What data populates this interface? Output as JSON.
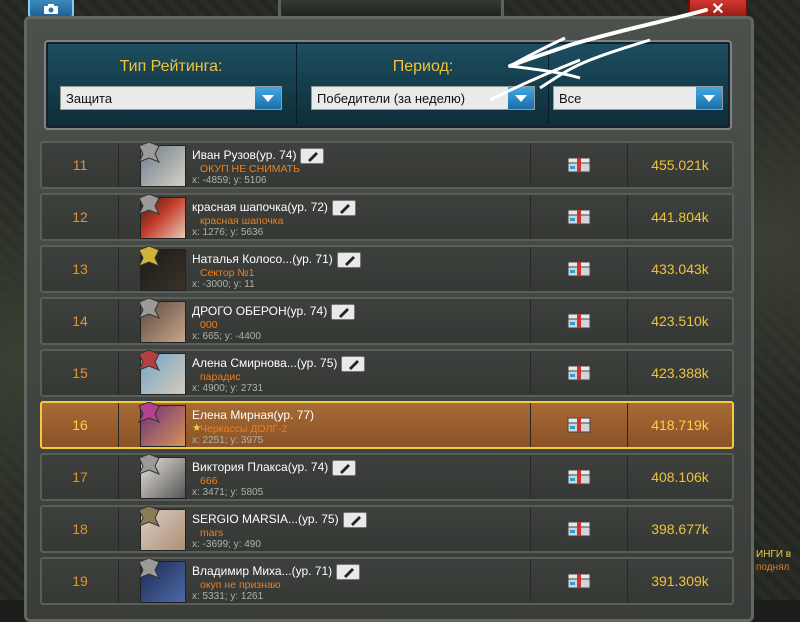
{
  "close_label": "✕",
  "filters": {
    "type_label": "Тип Рейтинга:",
    "type_value": "Защита",
    "period_label": "Период:",
    "period_value": "Победители (за неделю)",
    "scope_value": "Все"
  },
  "rows": [
    {
      "rank": "11",
      "name": "Иван Рузов(ур. 74)",
      "clan": "ОКУП НЕ СНИМАТЬ",
      "coords": "x: -4859; y: 5106",
      "score": "455.021k"
    },
    {
      "rank": "12",
      "name": "красная шапочка(ур. 72)",
      "clan": "красная шапочка",
      "coords": "x: 1276; y: 5636",
      "score": "441.804k"
    },
    {
      "rank": "13",
      "name": "Наталья Колосо...(ур. 71)",
      "clan": "Сектор №1",
      "coords": "x: -3000; y: 11",
      "score": "433.043k"
    },
    {
      "rank": "14",
      "name": "ДРОГО ОБЕРОН(ур. 74)",
      "clan": "000",
      "coords": "x: 665; y: -4400",
      "score": "423.510k"
    },
    {
      "rank": "15",
      "name": "Алена Смирнова...(ур. 75)",
      "clan": "парадис",
      "coords": "x: 4900; y: 2731",
      "score": "423.388k"
    },
    {
      "rank": "16",
      "name": "Елена Мирная(ур. 77)",
      "clan": "Черкассы ДОЛГ-2",
      "coords": "x: 2251; y: 3975",
      "score": "418.719k",
      "highlight": true
    },
    {
      "rank": "17",
      "name": "Виктория Плакса(ур. 74)",
      "clan": "666",
      "coords": "x: 3471; y: 5805",
      "score": "408.106k"
    },
    {
      "rank": "18",
      "name": "SERGIO MARSIA...(ур. 75)",
      "clan": "mars",
      "coords": "x: -3699; y: 490",
      "score": "398.677k"
    },
    {
      "rank": "19",
      "name": "Владимир Миха...(ур. 71)",
      "clan": "окуп не признаю",
      "coords": "x: 5331; y: 1261",
      "score": "391.309k"
    }
  ],
  "side_text": {
    "line1": "ИНГИ в",
    "line2": "поднял"
  },
  "colors": {
    "accent_gold": "#f0c33b",
    "clan_orange": "#ee7f1f",
    "highlight_border": "#f3cb3f",
    "panel_teal": "#1d4f61"
  }
}
